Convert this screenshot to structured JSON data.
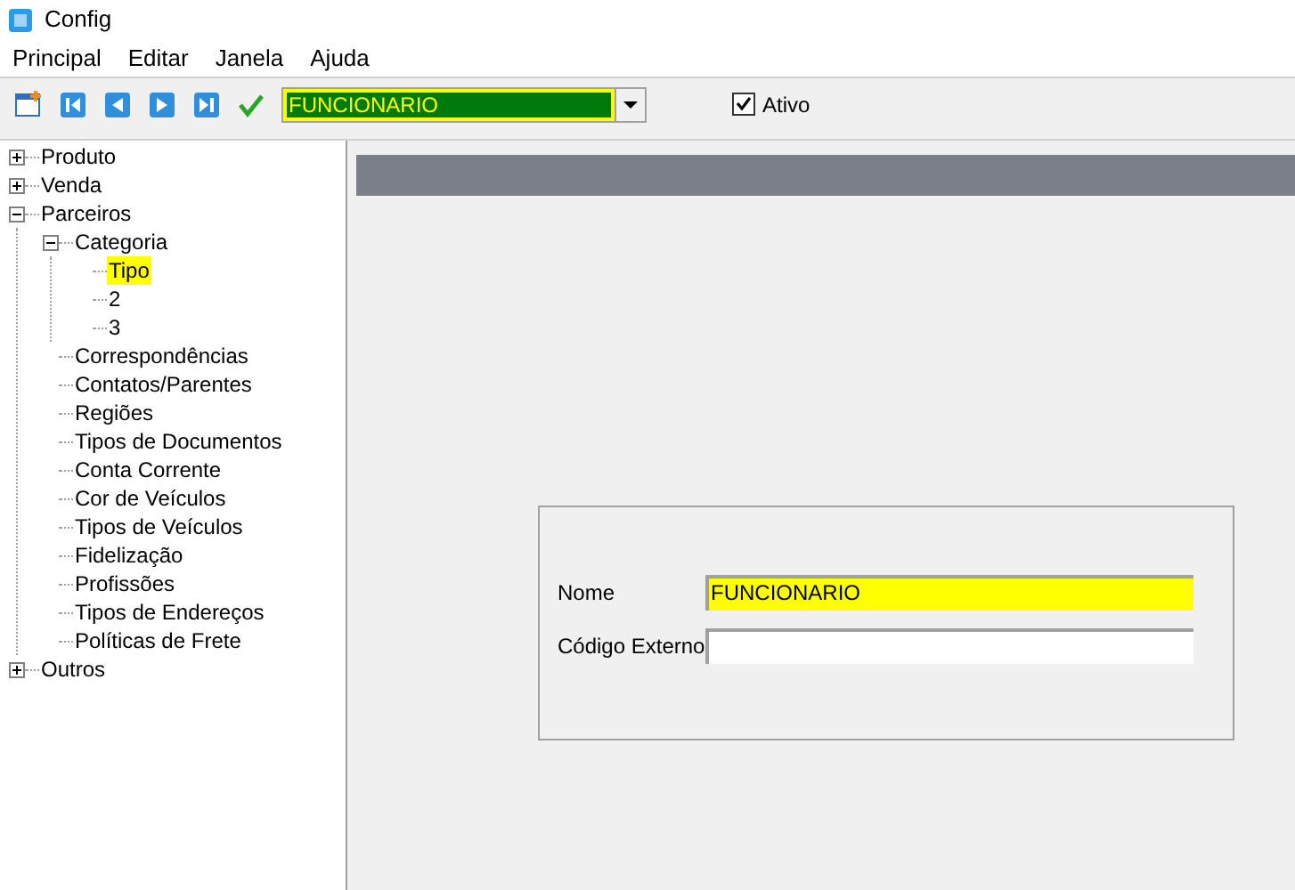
{
  "window": {
    "title": "Config"
  },
  "menu": [
    "Principal",
    "Editar",
    "Janela",
    "Ajuda"
  ],
  "toolbar": {
    "combo": {
      "value": "FUNCIONARIO"
    },
    "active_checkbox": {
      "label": "Ativo",
      "checked": true
    }
  },
  "tree": [
    {
      "label": "Produto",
      "expanded": false,
      "selected": false
    },
    {
      "label": "Venda",
      "expanded": false,
      "selected": false
    },
    {
      "label": "Parceiros",
      "expanded": true,
      "selected": false,
      "children": [
        {
          "label": "Categoria",
          "expanded": true,
          "selected": false,
          "children": [
            {
              "label": "Tipo",
              "selected": true
            },
            {
              "label": "2",
              "selected": false
            },
            {
              "label": "3",
              "selected": false
            }
          ]
        },
        {
          "label": "Correspondências",
          "selected": false
        },
        {
          "label": "Contatos/Parentes",
          "selected": false
        },
        {
          "label": "Regiões",
          "selected": false
        },
        {
          "label": "Tipos de Documentos",
          "selected": false
        },
        {
          "label": "Conta Corrente",
          "selected": false
        },
        {
          "label": "Cor de Veículos",
          "selected": false
        },
        {
          "label": "Tipos de Veículos",
          "selected": false
        },
        {
          "label": "Fidelização",
          "selected": false
        },
        {
          "label": "Profissões",
          "selected": false
        },
        {
          "label": "Tipos de Endereços",
          "selected": false
        },
        {
          "label": "Políticas de Frete",
          "selected": false
        }
      ]
    },
    {
      "label": "Outros",
      "expanded": false,
      "selected": false
    }
  ],
  "form": {
    "fields": [
      {
        "label": "Nome",
        "value": "FUNCIONARIO",
        "highlighted": true
      },
      {
        "label": "Código Externo",
        "highlighted": false
      }
    ]
  }
}
